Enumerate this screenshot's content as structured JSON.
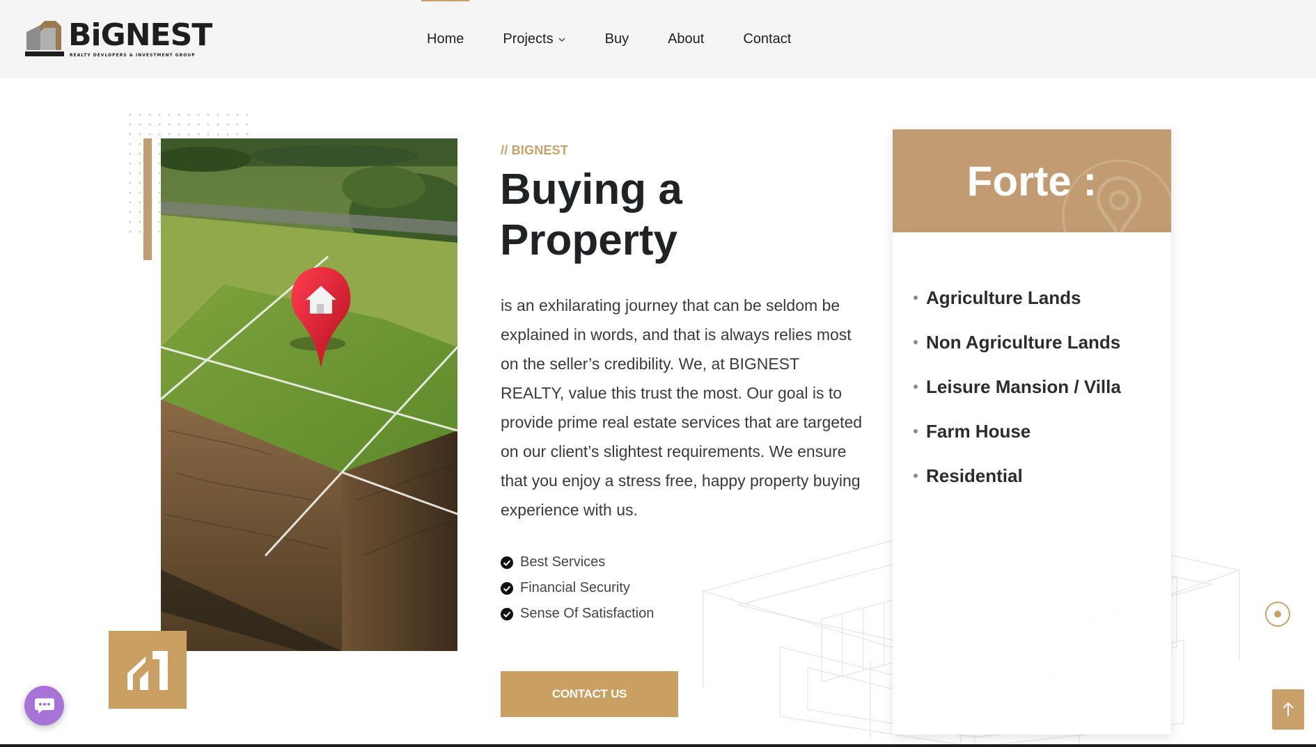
{
  "header": {
    "logo": {
      "wordmark": "BiGNEST",
      "tagline": "REALTY DEVLOPERS & INVESTMENT GROUP"
    },
    "nav": [
      {
        "label": "Home",
        "active": true
      },
      {
        "label": "Projects",
        "has_dropdown": true
      },
      {
        "label": "Buy"
      },
      {
        "label": "About"
      },
      {
        "label": "Contact"
      }
    ]
  },
  "intro": {
    "eyebrow": "// BIGNEST",
    "title_line1": "Buying a",
    "title_line2": "Property",
    "paragraph": "is an exhilarating journey that can be seldom be explained in words, and that is always relies most on the seller’s credibility. We, at BIGNEST REALTY, value this trust the most. Our goal is to provide prime real estate services that are targeted on our client’s slightest requirements. We ensure that you enjoy a stress free, happy property buying experience with us.",
    "checklist": [
      "Best Services",
      "Financial Security",
      "Sense Of Satisfaction"
    ],
    "cta_label": "CONTACT US"
  },
  "forte": {
    "title": "Forte :",
    "items": [
      "Agriculture Lands",
      "Non Agriculture Lands",
      "Leisure Mansion / Villa",
      "Farm House",
      "Residential"
    ]
  },
  "icons": {
    "check": "check-circle-icon",
    "pin": "map-pin-icon",
    "chat": "chat-bubble-icon",
    "scroll_top": "arrow-up-icon",
    "badge": "house-logo-icon"
  },
  "colors": {
    "accent_gold": "#c9a061",
    "card_header": "#c19c72",
    "chat_purple": "#a873d6",
    "text_dark": "#1f2326"
  }
}
